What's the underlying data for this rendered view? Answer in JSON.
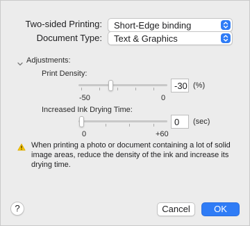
{
  "colors": {
    "accent": "#2f7cf6",
    "warning": "#f5c400"
  },
  "print_options": {
    "two_sided_label": "Two-sided Printing:",
    "two_sided_value": "Short-Edge binding",
    "document_type_label": "Document Type:",
    "document_type_value": "Text & Graphics"
  },
  "adjustments": {
    "section_label": "Adjustments:",
    "expanded": true,
    "print_density": {
      "label": "Print Density:",
      "min_label": "-50",
      "max_label": "0",
      "value": "-30",
      "unit": "(%)",
      "min": -50,
      "max": 0,
      "current": -30
    },
    "drying_time": {
      "label": "Increased Ink Drying Time:",
      "min_label": "0",
      "max_label": "+60",
      "value": "0",
      "unit": "(sec)",
      "min": 0,
      "max": 60,
      "current": 0
    }
  },
  "warning": {
    "icon": "warning-triangle-icon",
    "text": "When printing a photo or document containing a lot of solid image areas, reduce the density of the ink and increase its drying time."
  },
  "footer": {
    "help_label": "?",
    "cancel_label": "Cancel",
    "ok_label": "OK"
  }
}
